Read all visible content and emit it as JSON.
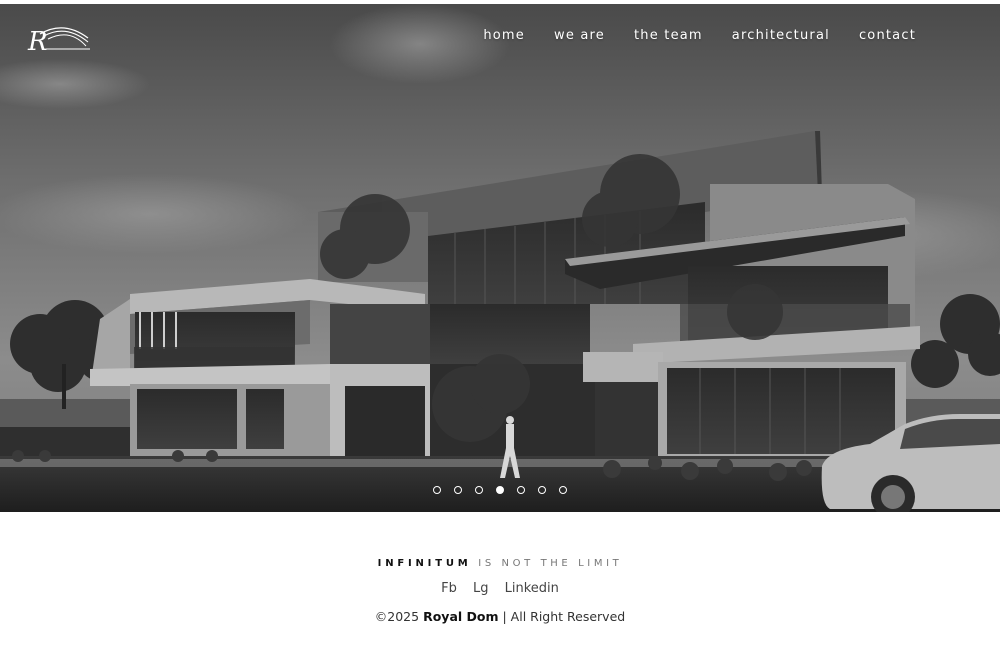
{
  "header": {
    "logo_icon": "royal-dom-r-logo",
    "nav": [
      {
        "label": "home"
      },
      {
        "label": "we are"
      },
      {
        "label": "the team"
      },
      {
        "label": "architectural"
      },
      {
        "label": "contact"
      }
    ]
  },
  "slider": {
    "slide_count": 7,
    "active_index": 3
  },
  "footer": {
    "tagline_brand": "INFINITUM",
    "tagline_rest": "IS NOT THE LIMIT",
    "social": [
      {
        "label": "Fb"
      },
      {
        "label": "Lg"
      },
      {
        "label": "Linkedin"
      }
    ],
    "copyright_prefix": "©2025",
    "copyright_brand": "Royal Dom",
    "copyright_suffix": "| All Right Reserved"
  }
}
